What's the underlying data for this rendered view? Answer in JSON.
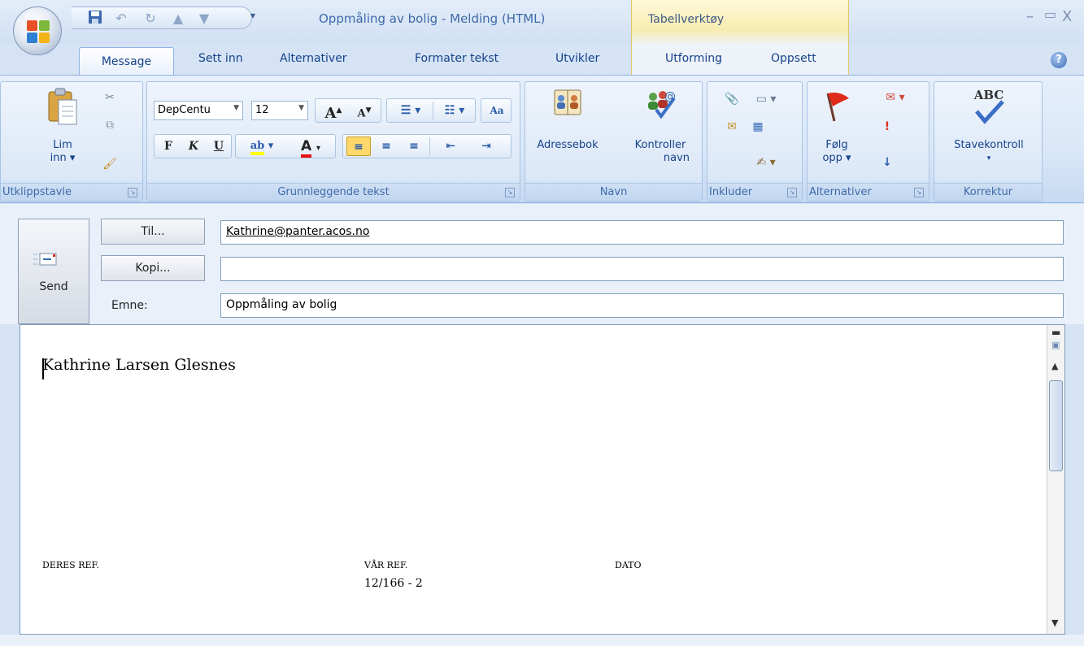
{
  "window": {
    "title": "Oppmåling av bolig - Melding (HTML)",
    "contextual_title": "Tabellverktøy",
    "minimize": "–",
    "maximize": "▭",
    "close": "X"
  },
  "tabs": [
    "Message",
    "Sett inn",
    "Alternativer",
    "Formater tekst",
    "Utvikler",
    "Utforming",
    "Oppsett"
  ],
  "help": "?",
  "ribbon": {
    "clipboard": {
      "paste_label_1": "Lim",
      "paste_label_2": "inn ▾",
      "group": "Utklippstavle"
    },
    "font": {
      "font_name": "DepCentu",
      "font_size": "12",
      "group": "Grunnleggende tekst",
      "bold": "F",
      "italic": "K",
      "underline": "U"
    },
    "names": {
      "address_book": "Adressebok",
      "check_names_1": "Kontroller",
      "check_names_2": "navn",
      "group": "Navn"
    },
    "include": {
      "group": "Inkluder"
    },
    "options": {
      "follow_up_1": "Følg",
      "follow_up_2": "opp ▾",
      "group": "Alternativer"
    },
    "proofing": {
      "spelling": "Stavekontroll",
      "abc": "ABC",
      "group": "Korrektur"
    }
  },
  "header": {
    "send": "Send",
    "to_button": "Til...",
    "cc_button": "Kopi...",
    "subject_label": "Emne:",
    "to_value": "Kathrine@panter.acos.no",
    "cc_value": "",
    "subject_value": "Oppmåling av bolig"
  },
  "body": {
    "recipient_name": "Kathrine Larsen Glesnes",
    "deres_ref_label": "DERES REF.",
    "var_ref_label": "VÅR REF.",
    "var_ref_value": "12/166 - 2",
    "dato_label": "DATO"
  }
}
